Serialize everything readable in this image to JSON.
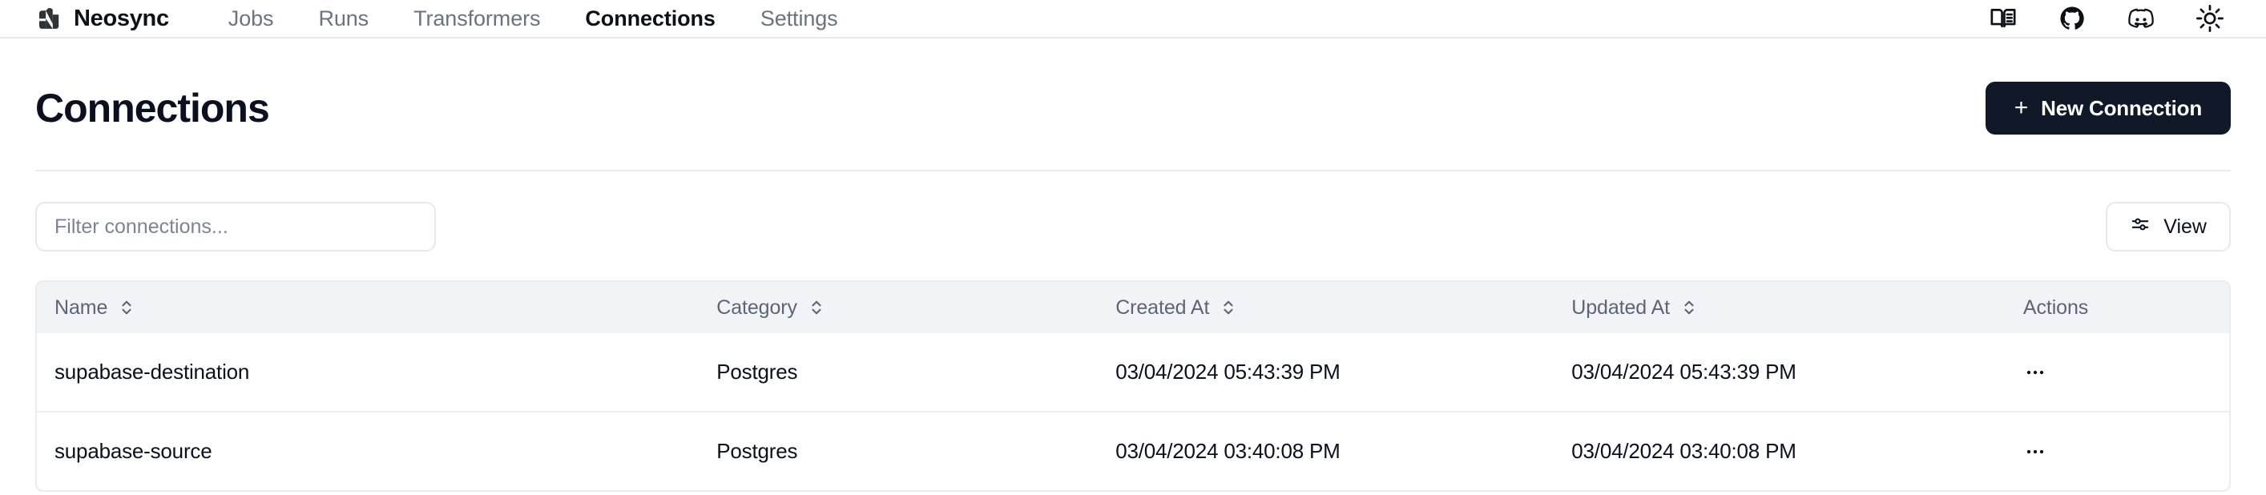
{
  "nav": {
    "brand": "Neosync",
    "logo_icon": "neosync-logo-icon",
    "links": [
      {
        "label": "Jobs",
        "active": false
      },
      {
        "label": "Runs",
        "active": false
      },
      {
        "label": "Transformers",
        "active": false
      },
      {
        "label": "Connections",
        "active": true
      },
      {
        "label": "Settings",
        "active": false
      }
    ],
    "icons": [
      {
        "name": "docs-book-icon"
      },
      {
        "name": "github-icon"
      },
      {
        "name": "discord-icon"
      },
      {
        "name": "sun-theme-icon"
      }
    ]
  },
  "header": {
    "title": "Connections",
    "new_connection_label": "New Connection",
    "new_connection_plus": "+"
  },
  "toolbar": {
    "filter_placeholder": "Filter connections...",
    "filter_value": "",
    "view_label": "View",
    "view_icon": "sliders-icon"
  },
  "table": {
    "columns": [
      {
        "key": "name",
        "label": "Name",
        "sortable": true
      },
      {
        "key": "category",
        "label": "Category",
        "sortable": true
      },
      {
        "key": "created_at",
        "label": "Created At",
        "sortable": true
      },
      {
        "key": "updated_at",
        "label": "Updated At",
        "sortable": true
      },
      {
        "key": "actions",
        "label": "Actions",
        "sortable": false
      }
    ],
    "rows": [
      {
        "name": "supabase-destination",
        "category": "Postgres",
        "created_at": "03/04/2024 05:43:39 PM",
        "updated_at": "03/04/2024 05:43:39 PM",
        "actions": "•••"
      },
      {
        "name": "supabase-source",
        "category": "Postgres",
        "created_at": "03/04/2024 03:40:08 PM",
        "updated_at": "03/04/2024 03:40:08 PM",
        "actions": "•••"
      }
    ]
  },
  "colors": {
    "accent_dark": "#111827",
    "text_primary": "#0b1020",
    "text_muted": "#6b7280",
    "border": "#e9ebef",
    "table_header_bg": "#f1f3f6"
  }
}
